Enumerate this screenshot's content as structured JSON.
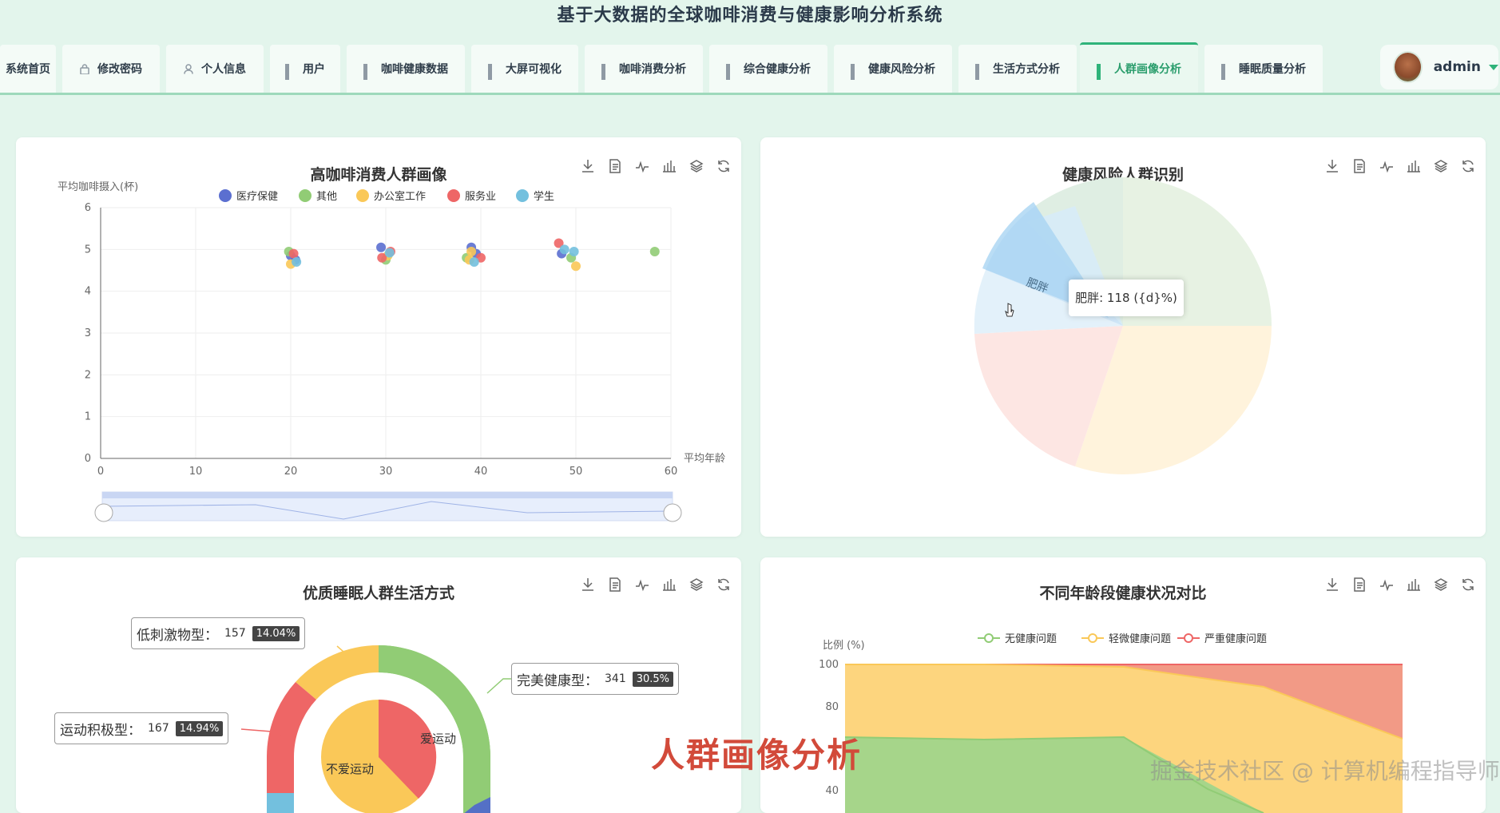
{
  "app": {
    "title": "基于大数据的全球咖啡消费与健康影响分析系统"
  },
  "nav": {
    "tabs": [
      {
        "label": "系统首页",
        "icon": "home-icon"
      },
      {
        "label": "修改密码",
        "icon": "lock-icon"
      },
      {
        "label": "个人信息",
        "icon": "person-icon"
      },
      {
        "label": "用户",
        "icon": "grid-icon"
      },
      {
        "label": "咖啡健康数据",
        "icon": "grid-icon"
      },
      {
        "label": "大屏可视化",
        "icon": "grid-icon"
      },
      {
        "label": "咖啡消费分析",
        "icon": "grid-icon"
      },
      {
        "label": "综合健康分析",
        "icon": "grid-icon"
      },
      {
        "label": "健康风险分析",
        "icon": "grid-icon"
      },
      {
        "label": "生活方式分析",
        "icon": "grid-icon"
      },
      {
        "label": "人群画像分析",
        "icon": "grid-icon",
        "active": true
      },
      {
        "label": "睡眠质量分析",
        "icon": "grid-icon"
      }
    ],
    "user": "admin"
  },
  "overlay": {
    "caption": "人群画像分析",
    "watermark": "掘金技术社区 @ 计算机编程指导师"
  },
  "tooltip": {
    "text": "肥胖: 118 ({d}%)"
  },
  "chart_data": [
    {
      "type": "scatter",
      "title": "高咖啡消费人群画像",
      "xlabel": "平均年龄",
      "ylabel": "平均咖啡摄入(杯)",
      "xlim": [
        0,
        60
      ],
      "ylim": [
        0,
        6
      ],
      "xticks": [
        "0",
        "10",
        "20",
        "30",
        "40",
        "50",
        "60"
      ],
      "yticks": [
        "0",
        "1",
        "2",
        "3",
        "4",
        "5",
        "6"
      ],
      "legend_position": "top",
      "series": [
        {
          "name": "医疗保健",
          "color": "#5b6fd0",
          "points": [
            [
              20,
              4.85
            ],
            [
              29.5,
              5.05
            ],
            [
              39,
              5.05
            ],
            [
              48.5,
              4.9
            ],
            [
              20.5,
              4.75
            ],
            [
              39.5,
              4.9
            ]
          ]
        },
        {
          "name": "其他",
          "color": "#91cc75",
          "points": [
            [
              19.8,
              4.95
            ],
            [
              30,
              4.75
            ],
            [
              38.5,
              4.8
            ],
            [
              49.5,
              4.8
            ],
            [
              58.3,
              4.95
            ]
          ]
        },
        {
          "name": "办公室工作",
          "color": "#fac858",
          "points": [
            [
              20,
              4.65
            ],
            [
              30.2,
              4.85
            ],
            [
              39,
              4.95
            ],
            [
              50,
              4.6
            ],
            [
              38.8,
              4.75
            ]
          ]
        },
        {
          "name": "服务业",
          "color": "#ee6666",
          "points": [
            [
              20.3,
              4.9
            ],
            [
              29.6,
              4.8
            ],
            [
              40,
              4.8
            ],
            [
              48.2,
              5.15
            ],
            [
              30.5,
              4.95
            ]
          ]
        },
        {
          "name": "学生",
          "color": "#73c0de",
          "points": [
            [
              20.6,
              4.7
            ],
            [
              30.4,
              4.92
            ],
            [
              39.3,
              4.7
            ],
            [
              48.8,
              5.0
            ],
            [
              49.8,
              4.95
            ]
          ]
        }
      ]
    },
    {
      "type": "pie",
      "title": "健康风险人群识别",
      "slices": [
        {
          "label": "肥胖",
          "value": 118
        }
      ]
    },
    {
      "type": "pie",
      "title": "优质睡眠人群生活方式",
      "slices": [
        {
          "label": "完美健康型",
          "value": 341,
          "percent": "30.5%"
        },
        {
          "label": "运动积极型",
          "value": 167,
          "percent": "14.94%"
        },
        {
          "label": "低刺激物型",
          "value": 157,
          "percent": "14.04%"
        }
      ],
      "inner_slices": [
        {
          "label": "爱运动"
        },
        {
          "label": "不爱运动"
        }
      ]
    },
    {
      "type": "area",
      "title": "不同年龄段健康状况对比",
      "ylabel": "比例 (%)",
      "yticks": [
        "100",
        "80",
        "40"
      ],
      "legend_position": "top",
      "series": [
        {
          "name": "无健康问题",
          "color": "#91cc75"
        },
        {
          "name": "轻微健康问题",
          "color": "#fac858"
        },
        {
          "name": "严重健康问题",
          "color": "#ee6666"
        }
      ]
    }
  ]
}
